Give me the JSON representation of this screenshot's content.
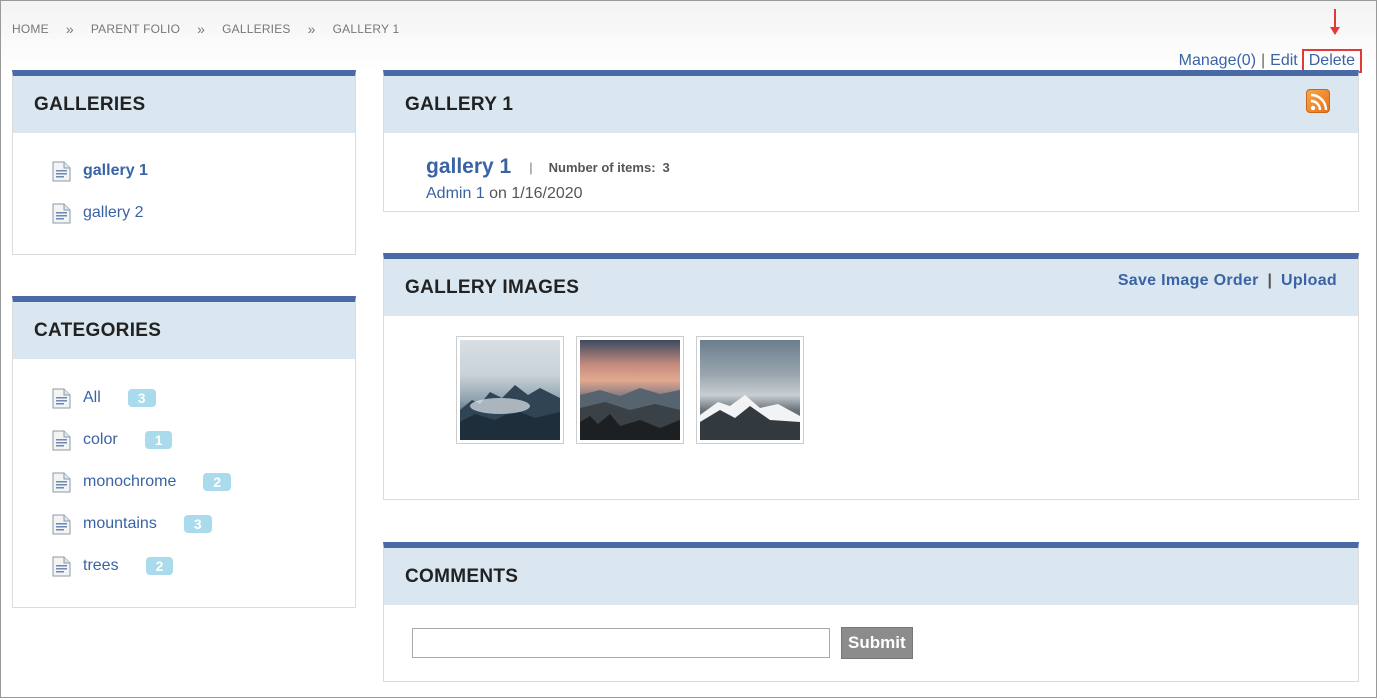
{
  "breadcrumb": {
    "items": [
      "HOME",
      "PARENT FOLIO",
      "GALLERIES",
      "GALLERY 1"
    ],
    "separator": "»"
  },
  "top_actions": {
    "manage": "Manage(0)",
    "edit": "Edit",
    "delete": "Delete",
    "pipe": "|",
    "highlight_color": "#e53935"
  },
  "galleries_panel": {
    "title": "GALLERIES",
    "items": [
      {
        "label": "gallery 1",
        "active": true
      },
      {
        "label": "gallery 2",
        "active": false
      }
    ]
  },
  "categories_panel": {
    "title": "CATEGORIES",
    "items": [
      {
        "label": "All",
        "count": "3"
      },
      {
        "label": "color",
        "count": "1"
      },
      {
        "label": "monochrome",
        "count": "2"
      },
      {
        "label": "mountains",
        "count": "3"
      },
      {
        "label": "trees",
        "count": "2"
      }
    ]
  },
  "gallery_panel": {
    "title": "GALLERY 1",
    "rss_icon": "rss-icon",
    "gallery_title": "gallery 1",
    "separator": "|",
    "items_label": "Number of items:",
    "items_count": "3",
    "author": "Admin 1",
    "date_text": "on 1/16/2020"
  },
  "images_panel": {
    "title": "GALLERY IMAGES",
    "save_order": "Save Image Order",
    "upload": "Upload",
    "pipe": "|"
  },
  "comments_panel": {
    "title": "COMMENTS",
    "input_value": "",
    "submit_label": "Submit"
  },
  "colors": {
    "accent": "#4a6aa5",
    "header_bg": "#dae7f0",
    "link": "#3a63a5",
    "badge": "#a9dbec"
  }
}
